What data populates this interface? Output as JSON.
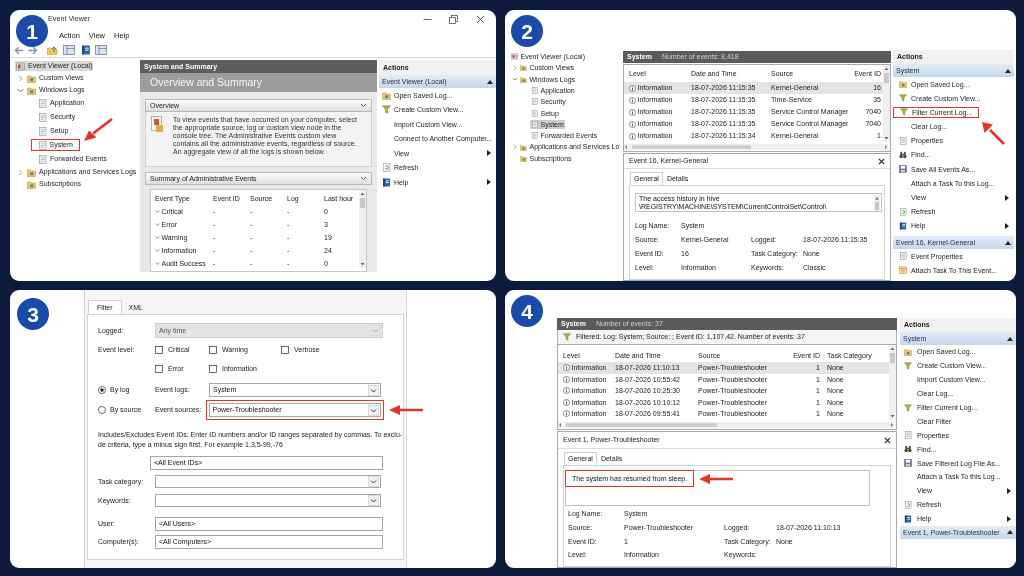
{
  "panels": [
    {
      "kind": "overview",
      "step": "1",
      "window": {
        "title": "Event Viewer",
        "menu": [
          "Action",
          "View",
          "Help"
        ]
      },
      "tree": [
        {
          "label": "Event Viewer (Local)",
          "kind": "root",
          "selected": true,
          "children": [
            {
              "label": "Custom Views",
              "kind": "folder",
              "expanded": false,
              "selected": false
            },
            {
              "label": "Windows Logs",
              "kind": "folder",
              "expanded": true,
              "selected": false,
              "children": [
                {
                  "label": "Application",
                  "kind": "log",
                  "selected": false
                },
                {
                  "label": "Security",
                  "kind": "log",
                  "selected": false
                },
                {
                  "label": "Setup",
                  "kind": "log",
                  "selected": false
                },
                {
                  "label": "System",
                  "kind": "log",
                  "selected": false,
                  "marked": true
                },
                {
                  "label": "Forwarded Events",
                  "kind": "log",
                  "selected": false
                }
              ]
            },
            {
              "label": "Applications and Services Logs",
              "kind": "folder",
              "expanded": false,
              "selected": false
            },
            {
              "label": "Subscriptions",
              "kind": "folder",
              "selected": false
            }
          ]
        }
      ],
      "center": {
        "header": "System and Summary",
        "title": "Overview and Summary",
        "overview": {
          "title": "Overview",
          "text": "To view events that have occurred on your computer, select the appropriate source, log or custom view node in the console tree. The Administrative Events custom view contains all the administrative events, regardless of source. An aggregate view of all the logs is shown below."
        },
        "summary": {
          "title": "Summary of Administrative Events",
          "columns": [
            "Event Type",
            "Event ID",
            "Source",
            "Log",
            "Last hour"
          ],
          "rows": [
            [
              "Critical",
              "-",
              "-",
              "-",
              "0"
            ],
            [
              "Error",
              "-",
              "-",
              "-",
              "3"
            ],
            [
              "Warning",
              "-",
              "-",
              "-",
              "19"
            ],
            [
              "Information",
              "-",
              "-",
              "-",
              "24"
            ],
            [
              "Audit Success",
              "-",
              "-",
              "-",
              "0"
            ]
          ]
        }
      },
      "actions": {
        "title": "Actions",
        "sections": [
          {
            "title": "Event Viewer (Local)",
            "expanded": true,
            "items": [
              {
                "label": "Open Saved Log...",
                "kind": "folder"
              },
              {
                "label": "Create Custom View...",
                "kind": "funnel"
              },
              {
                "label": "Import Custom View...",
                "kind": "plain"
              },
              {
                "label": "Connect to Another Computer...",
                "kind": "plain"
              },
              {
                "label": "View",
                "kind": "plain",
                "submenu": true
              },
              {
                "label": "Refresh",
                "kind": "refresh"
              },
              {
                "label": "Help",
                "kind": "help",
                "submenu": true
              }
            ]
          }
        ]
      }
    },
    {
      "kind": "log",
      "step": "2",
      "tree": [
        {
          "label": "Event Viewer (Local)",
          "kind": "root",
          "selected": false,
          "children": [
            {
              "label": "Custom Views",
              "kind": "folder",
              "expanded": false,
              "selected": false
            },
            {
              "label": "Windows Logs",
              "kind": "folder",
              "expanded": true,
              "selected": false,
              "children": [
                {
                  "label": "Application",
                  "kind": "log",
                  "selected": false
                },
                {
                  "label": "Security",
                  "kind": "log",
                  "selected": false
                },
                {
                  "label": "Setup",
                  "kind": "log",
                  "selected": false
                },
                {
                  "label": "System",
                  "kind": "log",
                  "selected": true
                },
                {
                  "label": "Forwarded Events",
                  "kind": "log",
                  "selected": false
                }
              ]
            },
            {
              "label": "Applications and Services Lo",
              "kind": "folder",
              "expanded": false,
              "selected": false
            },
            {
              "label": "Subscriptions",
              "kind": "folder",
              "selected": false
            }
          ]
        }
      ],
      "log": {
        "name": "System",
        "count": "Number of events: 8,418",
        "columns": [
          "Level",
          "Date and Time",
          "Source",
          "Event ID"
        ],
        "rows": [
          {
            "kind": "information",
            "selected": true,
            "cells": [
              "Information",
              "18-07-2026 11:15:35",
              "Kernel-General",
              "16"
            ]
          },
          {
            "kind": "information",
            "selected": false,
            "cells": [
              "Information",
              "18-07-2026 11:15:35",
              "Time-Service",
              "35"
            ]
          },
          {
            "kind": "information",
            "selected": false,
            "cells": [
              "Information",
              "18-07-2026 11:15:35",
              "Service Control Manager",
              "7040"
            ]
          },
          {
            "kind": "information",
            "selected": false,
            "cells": [
              "Information",
              "18-07-2026 11:15:35",
              "Service Control Manager",
              "7040"
            ]
          },
          {
            "kind": "information",
            "selected": false,
            "cells": [
              "Information",
              "18-07-2026 11:15:34",
              "Kernel-General",
              "1"
            ]
          }
        ]
      },
      "detail": {
        "title": "Event 16, Kernel-General",
        "tabs": [
          {
            "label": "General",
            "selected": true
          },
          {
            "label": "Details",
            "selected": false
          }
        ],
        "message": {
          "text": "The access history in hive \\REGISTRY\\MACHINE\\SYSTEM\\CurrentControlSet\\Control\\"
        },
        "field_rows": [
          [
            {
              "label": "Log Name:",
              "value": "System"
            }
          ],
          [
            {
              "label": "Source:",
              "value": "Kernel-General"
            },
            {
              "label": "Logged:",
              "value": "18-07-2026 11:15:35"
            }
          ],
          [
            {
              "label": "Event ID:",
              "value": "16"
            },
            {
              "label": "Task Category:",
              "value": "None"
            }
          ],
          [
            {
              "label": "Level:",
              "value": "Information"
            },
            {
              "label": "Keywords:",
              "value": "Classic"
            }
          ]
        ]
      },
      "actions": {
        "title": "Actions",
        "sections": [
          {
            "title": "System",
            "expanded": true,
            "items": [
              {
                "label": "Open Saved Log...",
                "kind": "folder"
              },
              {
                "label": "Create Custom View...",
                "kind": "funnel"
              },
              {
                "label": "Filter Current Log...",
                "kind": "funnel",
                "marked": true
              },
              {
                "label": "Clear Log...",
                "kind": "plain"
              },
              {
                "label": "Properties",
                "kind": "properties"
              },
              {
                "label": "Find...",
                "kind": "find"
              },
              {
                "label": "Save All Events As...",
                "kind": "save"
              },
              {
                "label": "Attach a Task To this Log...",
                "kind": "plain"
              },
              {
                "label": "View",
                "kind": "plain",
                "submenu": true
              },
              {
                "label": "Refresh",
                "kind": "refresh"
              },
              {
                "label": "Help",
                "kind": "help",
                "submenu": true
              }
            ]
          },
          {
            "title": "Event 16, Kernel-General",
            "expanded": true,
            "items": [
              {
                "label": "Event Properties",
                "kind": "properties"
              },
              {
                "label": "Attach Task To This Event...",
                "kind": "task"
              }
            ]
          }
        ]
      }
    },
    {
      "kind": "filter",
      "step": "3",
      "tabs": [
        {
          "label": "Filter",
          "selected": true
        },
        {
          "label": "XML",
          "selected": false
        }
      ],
      "logged": {
        "label": "Logged:",
        "value": "Any time",
        "disabled": true
      },
      "event_level": {
        "label": "Event level:",
        "options": [
          {
            "label": "Critical",
            "checked": false
          },
          {
            "label": "Warning",
            "checked": false
          },
          {
            "label": "Verbose",
            "checked": false
          },
          {
            "label": "Error",
            "checked": false
          },
          {
            "label": "Information",
            "checked": false
          }
        ]
      },
      "scope": [
        {
          "label": "By log",
          "selected": true,
          "field": {
            "label": "Event logs:",
            "value": "System"
          }
        },
        {
          "label": "By source",
          "selected": false,
          "field": {
            "label": "Event sources:",
            "value": "Power-Troubleshooter",
            "marked": true
          }
        }
      ],
      "event_ids": {
        "description": "Includes/Excludes Event IDs: Enter ID numbers and/or ID ranges separated by commas. To exclu-de criteria, type a minus sign first. For example 1,3,5-99,-76",
        "value": "<All Event IDs>"
      },
      "fields": [
        {
          "kind": "dropdown",
          "label": "Task category:"
        },
        {
          "kind": "dropdown",
          "label": "Keywords:"
        },
        {
          "kind": "text",
          "label": "User:",
          "value": "<All Users>"
        },
        {
          "kind": "text",
          "label": "Computer(s):",
          "value": "<All Computers>"
        }
      ]
    },
    {
      "kind": "filtered_log",
      "step": "4",
      "log": {
        "name": "System",
        "count": "Number of events: 37",
        "filter": "Filtered: Log: System; Source: ; Event ID: 1,107,42. Number of events: 37",
        "columns": [
          "Level",
          "Date and Time",
          "Source",
          "Event ID",
          "Task Category"
        ],
        "rows": [
          {
            "kind": "information",
            "selected": true,
            "cells": [
              "Information",
              "18-07-2026 11:10:13",
              "Power-Troubleshooter",
              "1",
              "None"
            ]
          },
          {
            "kind": "information",
            "selected": false,
            "cells": [
              "Information",
              "18-07-2026 10:55:42",
              "Power-Troubleshooter",
              "1",
              "None"
            ]
          },
          {
            "kind": "information",
            "selected": false,
            "cells": [
              "Information",
              "18-07-2026 10:25:30",
              "Power-Troubleshooter",
              "1",
              "None"
            ]
          },
          {
            "kind": "information",
            "selected": false,
            "cells": [
              "Information",
              "18-07-2026 10:10:12",
              "Power-Troubleshooter",
              "1",
              "None"
            ]
          },
          {
            "kind": "information",
            "selected": false,
            "cells": [
              "Information",
              "18-07-2026 09:55:41",
              "Power-Troubleshooter",
              "1",
              "None"
            ]
          }
        ]
      },
      "detail": {
        "title": "Event 1, Power-Troubleshooter",
        "tabs": [
          {
            "label": "General",
            "selected": true
          },
          {
            "label": "Details",
            "selected": false
          }
        ],
        "message": {
          "text": "The system has resumed from sleep.",
          "marked": true
        },
        "field_rows": [
          [
            {
              "label": "Log Name:",
              "value": "System"
            }
          ],
          [
            {
              "label": "Source:",
              "value": "Power-Troubleshooter"
            },
            {
              "label": "Logged:",
              "value": "18-07-2026 11:10:13"
            }
          ],
          [
            {
              "label": "Event ID:",
              "value": "1"
            },
            {
              "label": "Task Category:",
              "value": "None"
            }
          ],
          [
            {
              "label": "Level:",
              "value": "Information"
            },
            {
              "label": "Keywords:"
            }
          ]
        ]
      },
      "actions": {
        "title": "Actions",
        "sections": [
          {
            "title": "System",
            "expanded": true,
            "items": [
              {
                "label": "Open Saved Log...",
                "kind": "folder"
              },
              {
                "label": "Create Custom View...",
                "kind": "funnel"
              },
              {
                "label": "Import Custom View...",
                "kind": "plain"
              },
              {
                "label": "Clear Log...",
                "kind": "plain"
              },
              {
                "label": "Filter Current Log...",
                "kind": "funnel"
              },
              {
                "label": "Clear Filter",
                "kind": "plain"
              },
              {
                "label": "Properties",
                "kind": "properties"
              },
              {
                "label": "Find...",
                "kind": "find"
              },
              {
                "label": "Save Filtered Log File As...",
                "kind": "save"
              },
              {
                "label": "Attach a Task To this Log...",
                "kind": "plain"
              },
              {
                "label": "View",
                "kind": "plain",
                "submenu": true
              },
              {
                "label": "Refresh",
                "kind": "refresh"
              },
              {
                "label": "Help",
                "kind": "help",
                "submenu": true
              }
            ]
          },
          {
            "title": "Event 1, Power-Troubleshooter",
            "expanded": true
          }
        ]
      }
    }
  ]
}
